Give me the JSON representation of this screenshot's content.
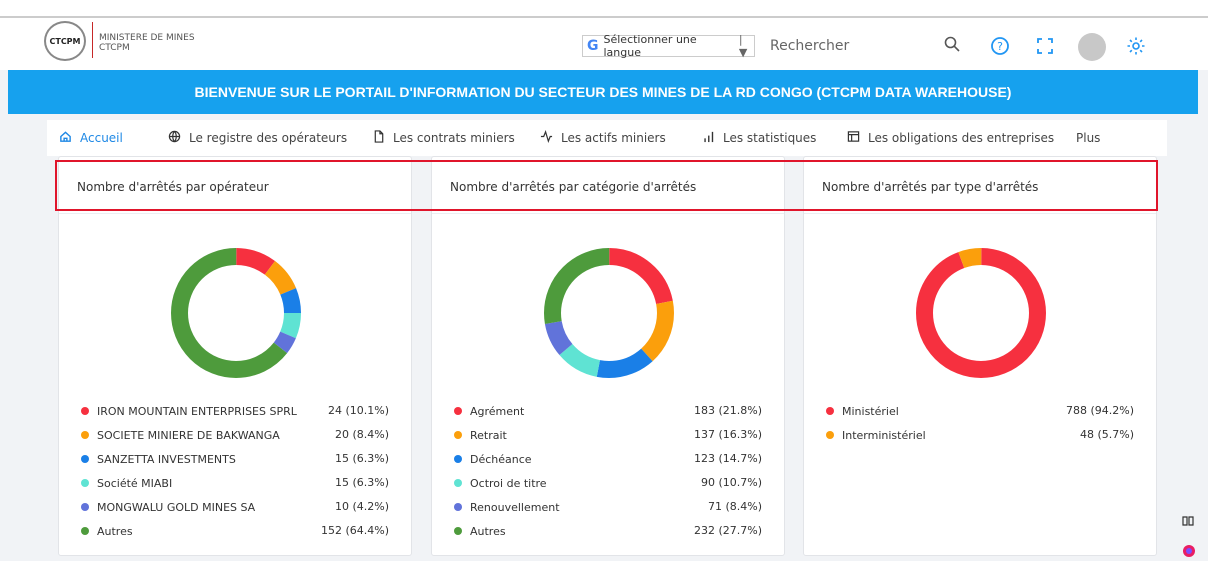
{
  "header": {
    "logo_text": "CTCPM",
    "org_line1": "MINISTERE DE MINES",
    "org_line2": "CTCPM",
    "language_select": "Sélectionner une langue",
    "search_placeholder": "Rechercher"
  },
  "banner": {
    "text": "BIENVENUE SUR LE PORTAIL D'INFORMATION DU SECTEUR DES MINES DE LA RD CONGO (CTCPM DATA WAREHOUSE)"
  },
  "nav": {
    "items": [
      {
        "label": "Accueil",
        "icon": "home-icon"
      },
      {
        "label": "Le registre des opérateurs",
        "icon": "globe-icon"
      },
      {
        "label": "Les contrats miniers",
        "icon": "document-icon"
      },
      {
        "label": "Les actifs miniers",
        "icon": "activity-icon"
      },
      {
        "label": "Les statistiques",
        "icon": "bar-chart-icon"
      },
      {
        "label": "Les obligations des entreprises",
        "icon": "table-icon"
      },
      {
        "label": "Plus",
        "icon": ""
      }
    ]
  },
  "colors": {
    "accent": "#16a1ee",
    "highlight": "#e0152b"
  },
  "cards": [
    {
      "title": "Nombre d'arrêtés par opérateur"
    },
    {
      "title": "Nombre d'arrêtés par catégorie d'arrêtés"
    },
    {
      "title": "Nombre d'arrêtés par type d'arrêtés"
    }
  ],
  "chart_data": [
    {
      "type": "pie",
      "donut": true,
      "title": "Nombre d'arrêtés par opérateur",
      "series": [
        {
          "name": "IRON MOUNTAIN ENTERPRISES SPRL",
          "value": 24,
          "label": "24 (10.1%)",
          "color": "#f6303f"
        },
        {
          "name": "SOCIETE MINIERE DE BAKWANGA",
          "value": 20,
          "label": "20 (8.4%)",
          "color": "#fb9f0c"
        },
        {
          "name": "SANZETTA INVESTMENTS",
          "value": 15,
          "label": "15 (6.3%)",
          "color": "#1a7fe7"
        },
        {
          "name": "Société MIABI",
          "value": 15,
          "label": "15 (6.3%)",
          "color": "#5fe3d3"
        },
        {
          "name": "MONGWALU GOLD MINES SA",
          "value": 10,
          "label": "10 (4.2%)",
          "color": "#6173da"
        },
        {
          "name": "Autres",
          "value": 152,
          "label": "152 (64.4%)",
          "color": "#4e9b3c"
        }
      ]
    },
    {
      "type": "pie",
      "donut": true,
      "title": "Nombre d'arrêtés par catégorie d'arrêtés",
      "series": [
        {
          "name": "Agrément",
          "value": 183,
          "label": "183 (21.8%)",
          "color": "#f6303f"
        },
        {
          "name": "Retrait",
          "value": 137,
          "label": "137 (16.3%)",
          "color": "#fb9f0c"
        },
        {
          "name": "Déchéance",
          "value": 123,
          "label": "123 (14.7%)",
          "color": "#1a7fe7"
        },
        {
          "name": "Octroi de titre",
          "value": 90,
          "label": "90 (10.7%)",
          "color": "#5fe3d3"
        },
        {
          "name": "Renouvellement",
          "value": 71,
          "label": "71 (8.4%)",
          "color": "#6173da"
        },
        {
          "name": "Autres",
          "value": 232,
          "label": "232 (27.7%)",
          "color": "#4e9b3c"
        }
      ]
    },
    {
      "type": "pie",
      "donut": true,
      "title": "Nombre d'arrêtés par type d'arrêtés",
      "series": [
        {
          "name": "Ministériel",
          "value": 788,
          "label": "788 (94.2%)",
          "color": "#f6303f"
        },
        {
          "name": "Interministériel",
          "value": 48,
          "label": "48 (5.7%)",
          "color": "#fb9f0c"
        }
      ]
    }
  ]
}
